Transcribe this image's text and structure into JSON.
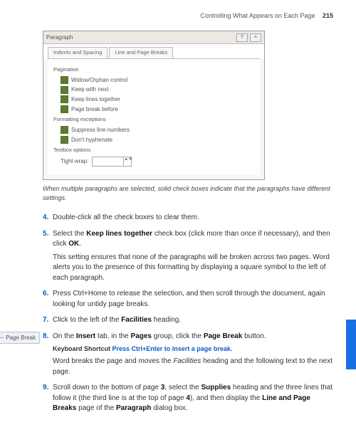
{
  "header": {
    "section_title": "Controlling What Appears on Each Page",
    "page_number": "215"
  },
  "dialog": {
    "title": "Paragraph",
    "close_glyph": "×",
    "help_glyph": "?",
    "tab1": "Indents and Spacing",
    "tab2": "Line and Page Breaks",
    "group_pagination": "Pagination",
    "cb_widow": "Widow/Orphan control",
    "cb_keepnext": "Keep with next",
    "cb_keeplines": "Keep lines together",
    "cb_pbb": "Page break before",
    "group_fmt": "Formatting exceptions",
    "cb_suppress": "Suppress line numbers",
    "cb_hyph": "Don't hyphenate",
    "group_textbox": "Textbox options",
    "tight_label": "Tight wrap:",
    "spinner_arrows": "▲▼"
  },
  "caption": "When multiple paragraphs are selected, solid check boxes indicate that the paragraphs have different settings.",
  "margin_chip": "Page Break",
  "steps": {
    "s4": "Double-click all the check boxes to clear them.",
    "s5a": "Select the ",
    "s5b": "Keep lines together",
    "s5c": " check box (click more than once if necessary), and then click ",
    "s5d": "OK",
    "s5e": ".",
    "s5p": "This setting ensures that none of the paragraphs will be broken across two pages. Word alerts you to the presence of this formatting by displaying a square symbol to the left of each paragraph.",
    "s6": "Press Ctrl+Home to release the selection, and then scroll through the document, again looking for untidy page breaks.",
    "s7a": "Click to the left of the ",
    "s7b": "Facilities",
    "s7c": " heading.",
    "s8a": "On the ",
    "s8b": "Insert",
    "s8c": " tab, in the ",
    "s8d": "Pages",
    "s8e": " group, click the ",
    "s8f": "Page Break",
    "s8g": " button.",
    "s8_kb_lead": "Keyboard Shortcut  ",
    "s8_kb": "Press Ctrl+Enter to insert a page break.",
    "s8p1a": "Word breaks the page and moves the ",
    "s8p1b": "Facilities",
    "s8p1c": " heading and the following text to the next page.",
    "s9a": "Scroll down to the bottom of page ",
    "s9b": "3",
    "s9c": ", select the ",
    "s9d": "Supplies",
    "s9e": " heading and the three lines that follow it (the third line is at the top of page ",
    "s9f": "4",
    "s9g": "), and then display the ",
    "s9h": "Line and Page Breaks",
    "s9i": " page of the ",
    "s9j": "Paragraph",
    "s9k": " dialog box."
  }
}
